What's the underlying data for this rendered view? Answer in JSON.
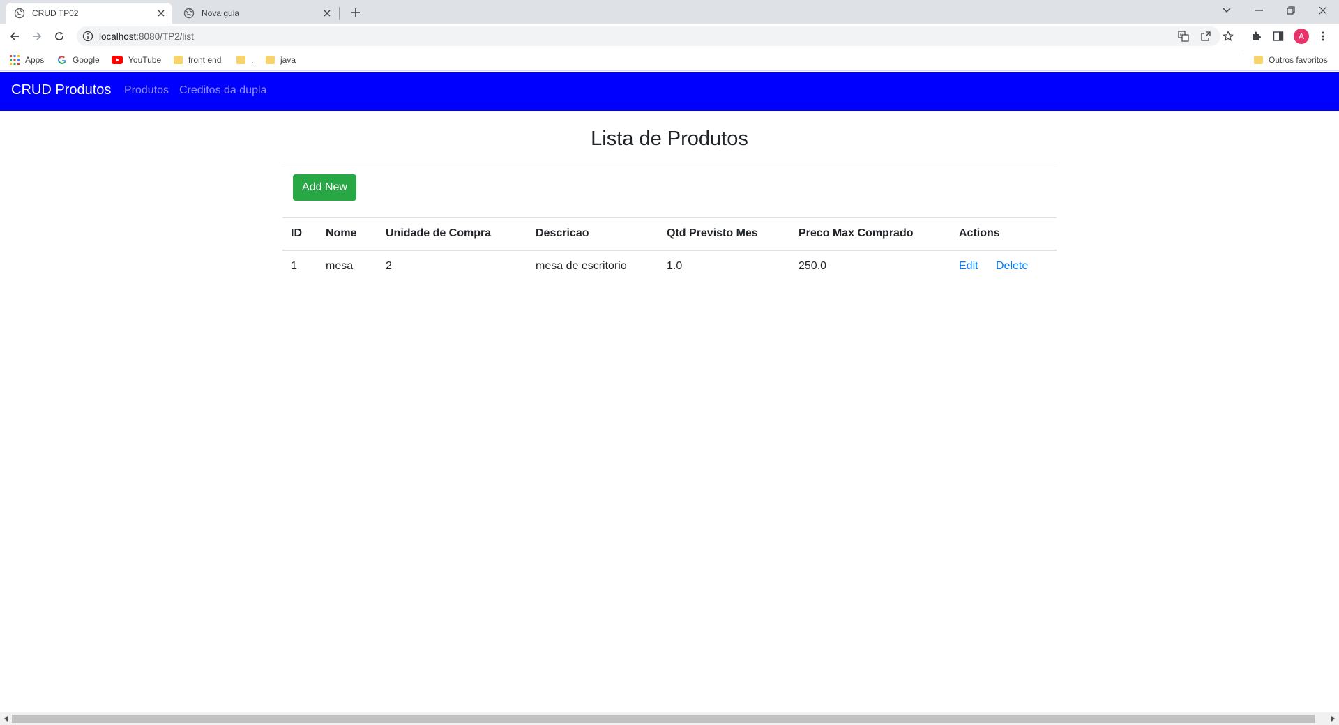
{
  "browser": {
    "tabs": [
      {
        "title": "CRUD TP02",
        "active": true
      },
      {
        "title": "Nova guia",
        "active": false
      }
    ],
    "url": {
      "host": "localhost",
      "path": ":8080/TP2/list"
    },
    "profile_initial": "A",
    "bookmarks": [
      {
        "label": "Apps",
        "icon": "apps-grid-icon"
      },
      {
        "label": "Google",
        "icon": "google-icon"
      },
      {
        "label": "YouTube",
        "icon": "youtube-icon"
      },
      {
        "label": "front end",
        "icon": "folder-icon"
      },
      {
        "label": ".",
        "icon": "folder-icon"
      },
      {
        "label": "java",
        "icon": "folder-icon"
      }
    ],
    "other_bookmarks": "Outros favoritos"
  },
  "navbar": {
    "brand": "CRUD Produtos",
    "links": [
      "Produtos",
      "Creditos da dupla"
    ],
    "bg_color": "#0000ff"
  },
  "page": {
    "title": "Lista de Produtos",
    "add_button": "Add New",
    "table": {
      "headers": [
        "ID",
        "Nome",
        "Unidade de Compra",
        "Descricao",
        "Qtd Previsto Mes",
        "Preco Max Comprado",
        "Actions"
      ],
      "rows": [
        {
          "id": "1",
          "nome": "mesa",
          "unidade": "2",
          "descricao": "mesa de escritorio",
          "qtd": "1.0",
          "preco": "250.0",
          "edit": "Edit",
          "delete": "Delete"
        }
      ]
    }
  }
}
